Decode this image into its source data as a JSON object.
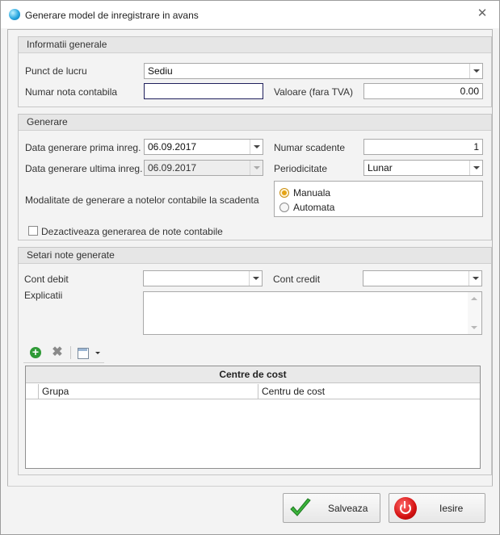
{
  "window": {
    "title": "Generare model de inregistrare in avans"
  },
  "general": {
    "header": "Informatii generale",
    "punct_label": "Punct de lucru",
    "punct_value": "Sediu",
    "nota_label": "Numar nota contabila",
    "nota_value": "",
    "valoare_label": "Valoare (fara TVA)",
    "valoare_value": "0.00"
  },
  "generare": {
    "header": "Generare",
    "data_prima_label": "Data generare prima inreg.",
    "data_prima_value": "06.09.2017",
    "data_ultima_label": "Data generare ultima inreg.",
    "data_ultima_value": "06.09.2017",
    "numar_scadente_label": "Numar scadente",
    "numar_scadente_value": "1",
    "periodicitate_label": "Periodicitate",
    "periodicitate_value": "Lunar",
    "modalitate_label": "Modalitate de generare a notelor contabile la scadenta",
    "modalitate_options": [
      {
        "label": "Manuala",
        "checked": true
      },
      {
        "label": "Automata",
        "checked": false
      }
    ],
    "dezactiveaza_label": "Dezactiveaza generarea de note contabile",
    "dezactiveaza_checked": false
  },
  "setari": {
    "header": "Setari note generate",
    "cont_debit_label": "Cont debit",
    "cont_debit_value": "",
    "cont_credit_label": "Cont credit",
    "cont_credit_value": "",
    "explicatii_label": "Explicatii",
    "explicatii_value": "",
    "toolbar_icons": [
      "plus-icon",
      "delete-icon",
      "layout-icon"
    ],
    "grid": {
      "band_title": "Centre de cost",
      "columns": [
        "Grupa",
        "Centru de cost"
      ],
      "rows": []
    }
  },
  "buttons": {
    "save": "Salveaza",
    "exit": "Iesire"
  },
  "colors": {
    "accent_focus": "#1f1f5c",
    "radio_checked": "#e5a314",
    "save_check": "#3bb33b",
    "exit_power": "#d41111"
  }
}
